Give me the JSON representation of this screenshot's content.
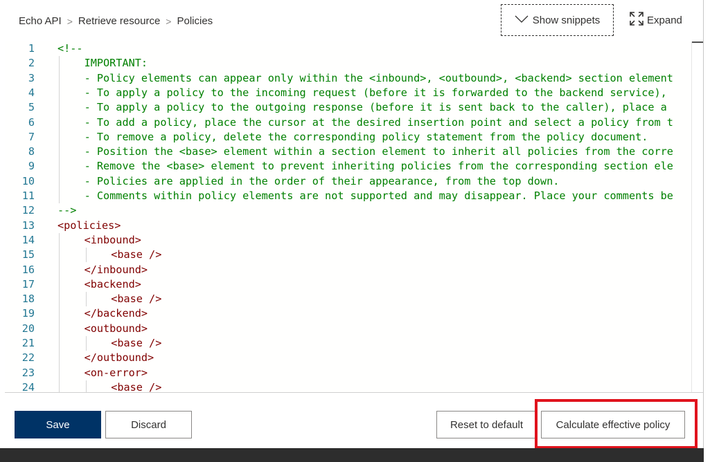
{
  "breadcrumb": {
    "items": [
      "Echo API",
      "Retrieve resource",
      "Policies"
    ],
    "separator": ">"
  },
  "toolbar": {
    "show_snippets_label": "Show snippets",
    "expand_label": "Expand"
  },
  "editor": {
    "lines": [
      {
        "n": "1",
        "indent": 0,
        "kind": "comment",
        "text": "<!--"
      },
      {
        "n": "2",
        "indent": 1,
        "kind": "comment",
        "text": "IMPORTANT:"
      },
      {
        "n": "3",
        "indent": 1,
        "kind": "comment",
        "text": "- Policy elements can appear only within the <inbound>, <outbound>, <backend> section element"
      },
      {
        "n": "4",
        "indent": 1,
        "kind": "comment",
        "text": "- To apply a policy to the incoming request (before it is forwarded to the backend service),"
      },
      {
        "n": "5",
        "indent": 1,
        "kind": "comment",
        "text": "- To apply a policy to the outgoing response (before it is sent back to the caller), place a"
      },
      {
        "n": "6",
        "indent": 1,
        "kind": "comment",
        "text": "- To add a policy, place the cursor at the desired insertion point and select a policy from t"
      },
      {
        "n": "7",
        "indent": 1,
        "kind": "comment",
        "text": "- To remove a policy, delete the corresponding policy statement from the policy document."
      },
      {
        "n": "8",
        "indent": 1,
        "kind": "comment",
        "text": "- Position the <base> element within a section element to inherit all policies from the corre"
      },
      {
        "n": "9",
        "indent": 1,
        "kind": "comment",
        "text": "- Remove the <base> element to prevent inheriting policies from the corresponding section ele"
      },
      {
        "n": "10",
        "indent": 1,
        "kind": "comment",
        "text": "- Policies are applied in the order of their appearance, from the top down."
      },
      {
        "n": "11",
        "indent": 1,
        "kind": "comment",
        "text": "- Comments within policy elements are not supported and may disappear. Place your comments be"
      },
      {
        "n": "12",
        "indent": 0,
        "kind": "comment",
        "text": "-->"
      },
      {
        "n": "13",
        "indent": 0,
        "kind": "tag",
        "text": "<policies>"
      },
      {
        "n": "14",
        "indent": 1,
        "kind": "tag",
        "text": "<inbound>"
      },
      {
        "n": "15",
        "indent": 2,
        "kind": "tag-self",
        "tag": "<base",
        "close": " />"
      },
      {
        "n": "16",
        "indent": 1,
        "kind": "tag",
        "text": "</inbound>"
      },
      {
        "n": "17",
        "indent": 1,
        "kind": "tag",
        "text": "<backend>"
      },
      {
        "n": "18",
        "indent": 2,
        "kind": "tag-self",
        "tag": "<base",
        "close": " />"
      },
      {
        "n": "19",
        "indent": 1,
        "kind": "tag",
        "text": "</backend>"
      },
      {
        "n": "20",
        "indent": 1,
        "kind": "tag",
        "text": "<outbound>"
      },
      {
        "n": "21",
        "indent": 2,
        "kind": "tag-self",
        "tag": "<base",
        "close": " />"
      },
      {
        "n": "22",
        "indent": 1,
        "kind": "tag",
        "text": "</outbound>"
      },
      {
        "n": "23",
        "indent": 1,
        "kind": "tag",
        "text": "<on-error>"
      },
      {
        "n": "24",
        "indent": 2,
        "kind": "tag-self",
        "tag": "<base",
        "close": " />"
      }
    ]
  },
  "footer": {
    "save_label": "Save",
    "discard_label": "Discard",
    "reset_label": "Reset to default",
    "calculate_label": "Calculate effective policy"
  },
  "colors": {
    "primary": "#003366",
    "comment": "#008000",
    "tag": "#800000",
    "line_number": "#237893",
    "highlight": "#e0131d"
  },
  "icons": {
    "snippets": "chevron-down-icon",
    "expand": "expand-icon"
  }
}
